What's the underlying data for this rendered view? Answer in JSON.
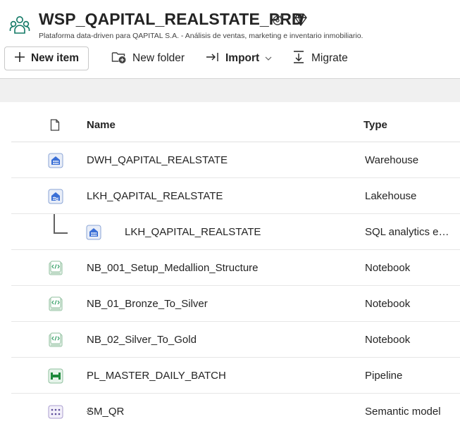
{
  "workspace": {
    "title": "WSP_QAPITAL_REALSTATE_PRD",
    "description": "Plataforma data-driven para QAPITAL S.A. - Análisis de ventas, marketing e inventario inmobiliario."
  },
  "toolbar": {
    "new_item": "New item",
    "new_folder": "New folder",
    "import": "Import",
    "migrate": "Migrate"
  },
  "table": {
    "columns": {
      "name": "Name",
      "type": "Type"
    },
    "rows": [
      {
        "name": "DWH_QAPITAL_REALSTATE",
        "type": "Warehouse",
        "icon": "warehouse-icon"
      },
      {
        "name": "LKH_QAPITAL_REALSTATE",
        "type": "Lakehouse",
        "icon": "lakehouse-icon"
      },
      {
        "name": "LKH_QAPITAL_REALSTATE",
        "type": "SQL analytics e…",
        "icon": "sql-endpoint-icon",
        "child": true
      },
      {
        "name": "NB_001_Setup_Medallion_Structure",
        "type": "Notebook",
        "icon": "notebook-icon"
      },
      {
        "name": "NB_01_Bronze_To_Silver",
        "type": "Notebook",
        "icon": "notebook-icon"
      },
      {
        "name": "NB_02_Silver_To_Gold",
        "type": "Notebook",
        "icon": "notebook-icon"
      },
      {
        "name": "PL_MASTER_DAILY_BATCH",
        "type": "Pipeline",
        "icon": "pipeline-icon"
      },
      {
        "name": "SM_QR",
        "type": "Semantic model",
        "icon": "semantic-model-icon"
      }
    ]
  },
  "colors": {
    "brand_teal": "#117865",
    "warehouse_blue": "#3a6fd6",
    "notebook_green": "#38a169",
    "pipeline_green": "#1e8a3c"
  }
}
